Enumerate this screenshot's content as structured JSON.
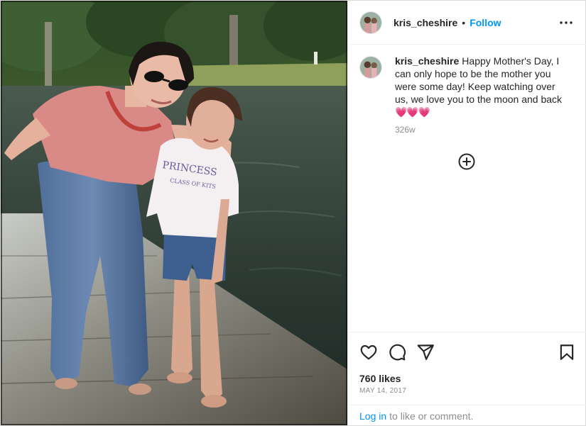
{
  "header": {
    "username": "kris_cheshire",
    "separator": "•",
    "follow_label": "Follow",
    "more_icon": "more-horizontal-icon"
  },
  "caption": {
    "username": "kris_cheshire",
    "text": "Happy Mother's Day, I can only hope to be the mother you were some day! Keep watching over us, we love you to the moon and back",
    "emoji": "💗💗💗",
    "age": "326w"
  },
  "load_more_icon": "plus-circle-icon",
  "actions": {
    "like_icon": "heart-icon",
    "comment_icon": "comment-icon",
    "share_icon": "send-icon",
    "save_icon": "bookmark-icon"
  },
  "likes": "760 likes",
  "date": "MAY 14, 2017",
  "login": {
    "link": "Log in",
    "rest": "to like or comment."
  },
  "photo": {
    "shirt_print_line1": "PRINCESS",
    "shirt_print_line2": "CLASS OF KITS"
  },
  "colors": {
    "accent": "#0095f6",
    "text": "#262626",
    "muted": "#8e8e8e",
    "border": "#efefef"
  }
}
